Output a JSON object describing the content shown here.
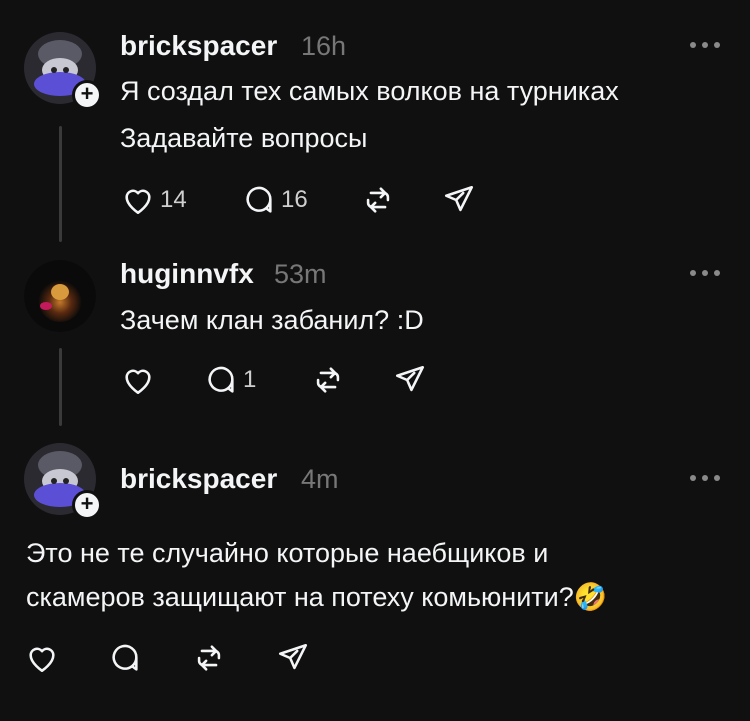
{
  "posts": [
    {
      "username": "brickspacer",
      "time": "16h",
      "lines": [
        "Я создал тех самых волков на турниках",
        "Задавайте вопросы"
      ],
      "likes": "14",
      "replies": "16"
    },
    {
      "username": "huginnvfx",
      "time": "53m",
      "lines": [
        "Зачем клан забанил? :D"
      ],
      "likes": "",
      "replies": "1"
    },
    {
      "username": "brickspacer",
      "time": "4m",
      "lines": [
        "Это не те случайно которые наебщиков и",
        "скамеров защищают на потеху комьюнити?"
      ],
      "emoji": "🤣",
      "likes": "",
      "replies": ""
    }
  ],
  "icons": {
    "like": "heart-icon",
    "reply": "comment-icon",
    "repost": "repost-icon",
    "share": "share-icon",
    "more": "more-icon"
  },
  "colors": {
    "background": "#101010",
    "text": "#f3f5f7",
    "muted": "#777777"
  }
}
